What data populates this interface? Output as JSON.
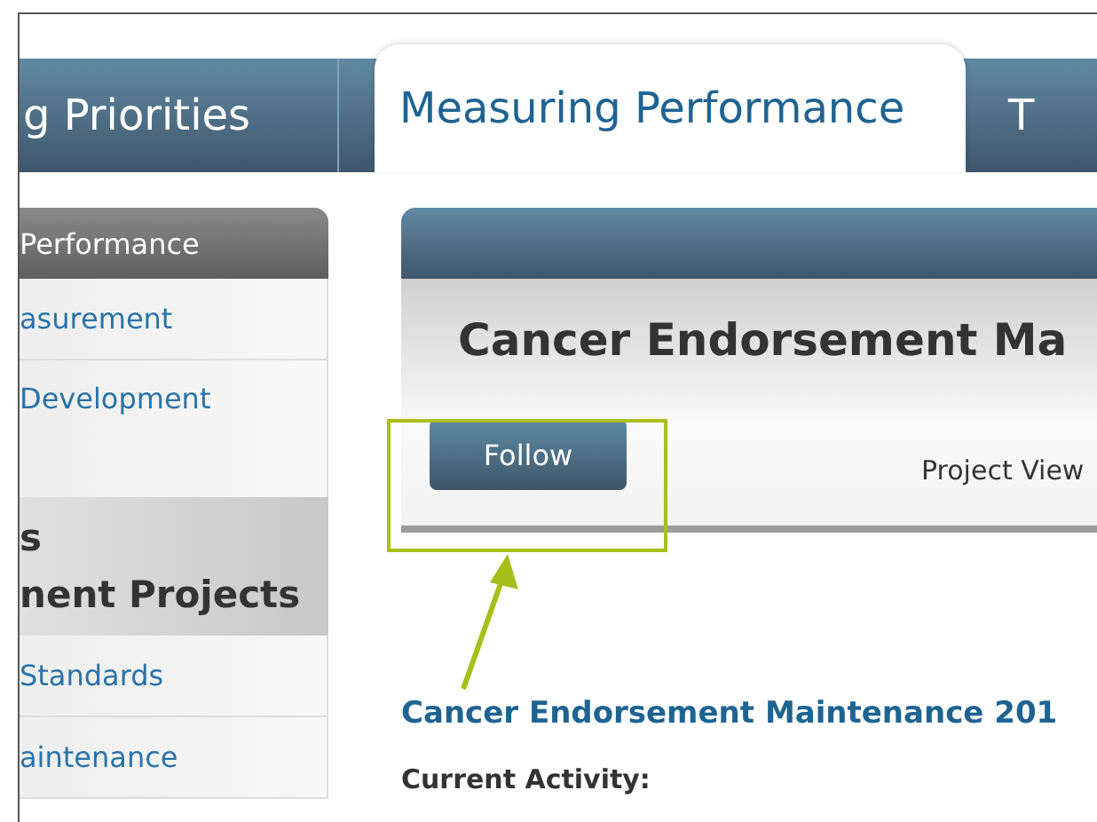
{
  "tabs": [
    {
      "label": "g Priorities",
      "selected": false
    },
    {
      "label": "Measuring Performance",
      "selected": true
    },
    {
      "label": "T",
      "selected": false
    }
  ],
  "sidebar": {
    "header": "Performance",
    "items": [
      {
        "kind": "link",
        "label": "asurement"
      },
      {
        "kind": "link",
        "label": "Development",
        "tall": true
      },
      {
        "kind": "heading",
        "lines": [
          "s",
          "nent Projects"
        ]
      },
      {
        "kind": "link",
        "label": "Standards"
      },
      {
        "kind": "link",
        "label": "aintenance"
      }
    ]
  },
  "main": {
    "title": "Cancer Endorsement Ma",
    "follow_button": "Follow",
    "project_view": "Project View",
    "project_title": "Cancer Endorsement Maintenance 201",
    "current_activity": "Current Activity:"
  }
}
